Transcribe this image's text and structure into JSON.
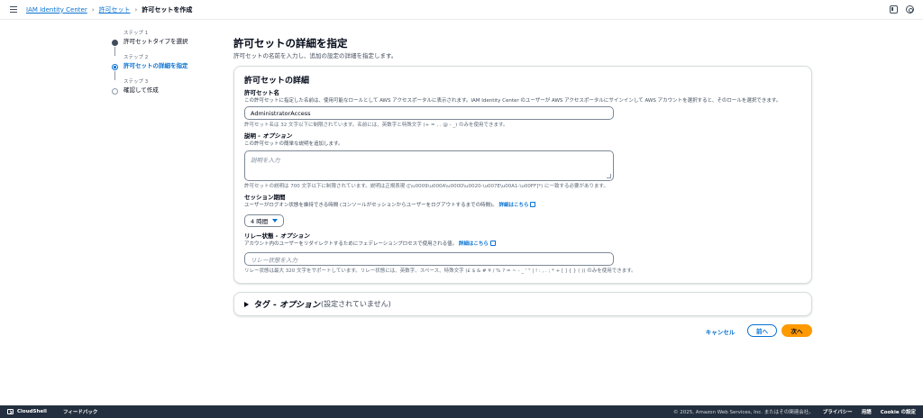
{
  "breadcrumb": {
    "items": [
      "IAM Identity Center",
      "許可セット"
    ],
    "current": "許可セットを作成"
  },
  "steps": [
    {
      "num": "ステップ 1",
      "title": "許可セットタイプを選択",
      "state": "done"
    },
    {
      "num": "ステップ 2",
      "title": "許可セットの詳細を指定",
      "state": "active"
    },
    {
      "num": "ステップ 3",
      "title": "確認して作成",
      "state": "pending"
    }
  ],
  "header": {
    "title": "許可セットの詳細を指定",
    "description": "許可セットの名前を入力し、追加の設定の詳細を指定します。"
  },
  "card": {
    "title": "許可セットの詳細",
    "name_field": {
      "label": "許可セット名",
      "hint": "この許可セットに指定した名前は、使用可能なロールとして AWS アクセスポータルに表示されます。IAM Identity Center のユーザーが AWS アクセスポータルにサインインして AWS アカウントを選択すると、そのロールを選択できます。",
      "value": "AdministratorAccess",
      "constraint": "許可セット名は 32 文字以下に制限されています。名前には、英数字と特殊文字 (+ = , . @ - _) のみを使用できます。"
    },
    "desc_field": {
      "label": "説明",
      "label_optional": " - オプション",
      "hint": "この許可セットの簡単な説明を追加します。",
      "placeholder": "説明を入力",
      "constraint": "許可セットの説明は 700 文字以下に制限されています。説明は正規表現 ([\\u0009\\u000A\\u000D\\u0020-\\u007E\\u00A1-\\u00FF]*) に一致する必要があります。"
    },
    "session_field": {
      "label": "セッション期間",
      "hint": "ユーザーがログオン状態を維持できる時間 (コンソールがセッションからユーザーをログアウトするまでの時間)。",
      "link": "詳細はこちら",
      "value": "4 時間"
    },
    "relay_field": {
      "label": "リレー状態",
      "label_optional": " - オプション",
      "hint": "アカウント内のユーザーをリダイレクトするためにフェデレーションプロセスで使用される値。",
      "link": "詳細はこちら",
      "placeholder": "リレー状態を入力",
      "constraint": "リレー状態は最大 320 文字をサポートしています。リレー状態には、英数字、スペース、特殊文字 (£ $ & # ¥ / % ? = ~ - _ ' \" | ! : , . ; * + [ ] { } ( )) のみを使用できます。"
    }
  },
  "tags": {
    "title": "タグ",
    "optional": " - オプション",
    "subtitle": "(設定されていません)"
  },
  "actions": {
    "cancel": "キャンセル",
    "prev": "前へ",
    "next": "次へ"
  },
  "footer": {
    "cloudshell": "CloudShell",
    "feedback": "フィードバック",
    "copyright": "© 2025, Amazon Web Services, Inc. またはその関連会社。",
    "privacy": "プライバシー",
    "terms": "用語",
    "cookie": "Cookie の設定"
  },
  "colors": {
    "accent": "#0972d3",
    "primary_button": "#ff9900",
    "footer_bg": "#232f3e"
  }
}
